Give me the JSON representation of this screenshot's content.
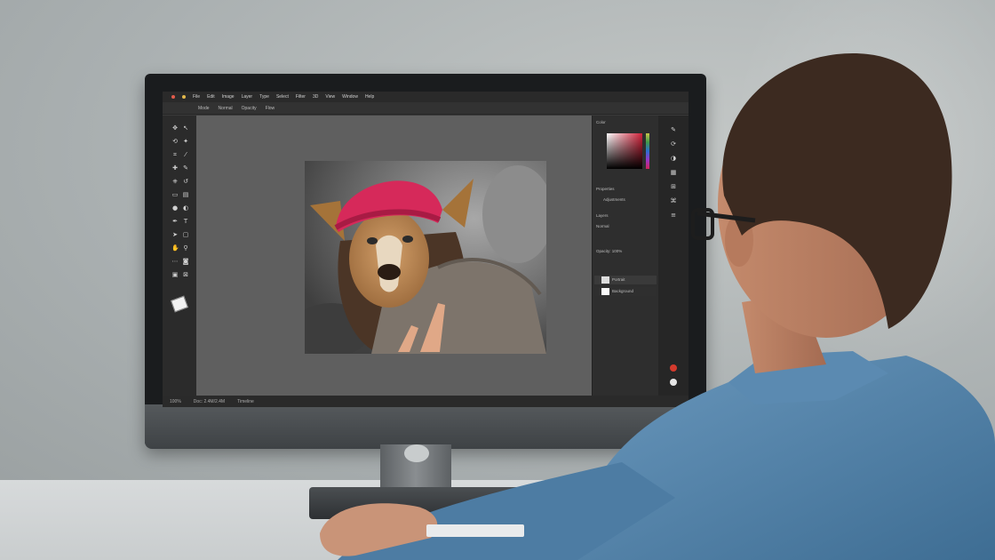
{
  "scene": {
    "description_colors": {
      "wall": "#aab0b1",
      "shirt": "#4f7ea4",
      "hair": "#3c2a20",
      "hat": "#d6295a"
    }
  },
  "photoshop": {
    "menu": [
      "File",
      "Edit",
      "Image",
      "Layer",
      "Type",
      "Select",
      "Filter",
      "3D",
      "View",
      "Window",
      "Help"
    ],
    "options": [
      "Mode",
      "Normal",
      "Opacity",
      "Flow"
    ],
    "panels": {
      "color_tab": "Color",
      "properties_tab": "Properties",
      "adjustments": "Adjustments",
      "layers_tab": "Layers",
      "blend_mode": "Normal",
      "opacity_label": "Opacity: 100%",
      "layer_items": [
        "Portrait",
        "Background"
      ]
    },
    "status": [
      "100%",
      "Doc: 2.4M/2.4M",
      "Timeline"
    ]
  },
  "accent_colors": [
    "#c8c44a",
    "#3f9a49",
    "#2a6fd1",
    "#9a35c8",
    "#d1245a"
  ]
}
